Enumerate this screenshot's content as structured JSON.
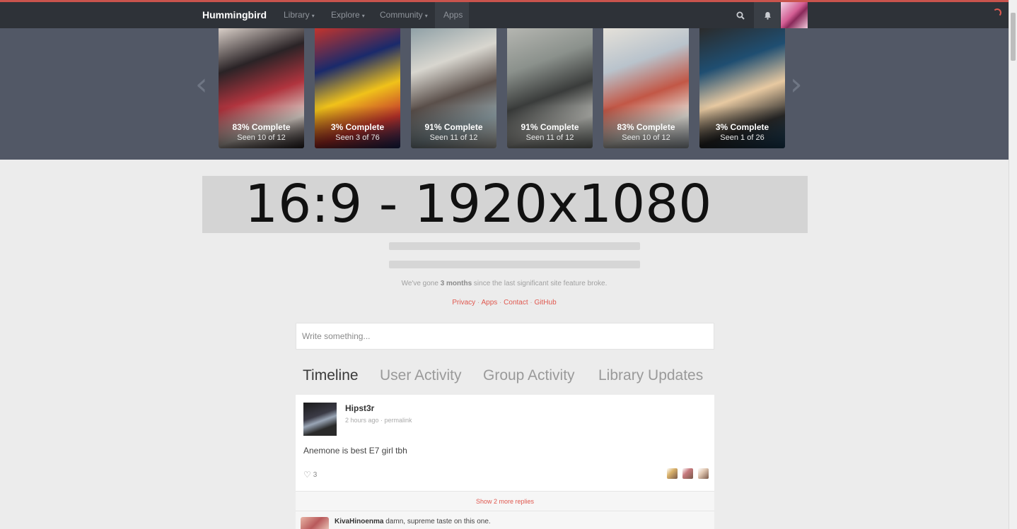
{
  "nav": {
    "brand": "Hummingbird",
    "items": [
      {
        "label": "Library",
        "dropdown": true
      },
      {
        "label": "Explore",
        "dropdown": true
      },
      {
        "label": "Community",
        "dropdown": true
      },
      {
        "label": "Apps",
        "dropdown": false
      }
    ],
    "caret": "▾",
    "icons": [
      "search-icon",
      "bell-icon",
      "user-avatar",
      "loading-spinner-icon"
    ]
  },
  "carousel": {
    "prev": "‹",
    "next": "›",
    "cards": [
      {
        "percent": "83% Complete",
        "seen": "Seen 10 of 12",
        "art_colors": [
          "#2a2326",
          "#b0343e",
          "#d9cfc8"
        ]
      },
      {
        "percent": "3% Complete",
        "seen": "Seen 3 of 76",
        "art_colors": [
          "#1a2a6b",
          "#f0c21a",
          "#c3342c"
        ]
      },
      {
        "percent": "91% Complete",
        "seen": "Seen 11 of 12",
        "art_colors": [
          "#d8d6cf",
          "#5a4f4a",
          "#8fa0a6"
        ]
      },
      {
        "percent": "91% Complete",
        "seen": "Seen 11 of 12",
        "art_colors": [
          "#8b918c",
          "#3a3c3b",
          "#b5b6b1"
        ]
      },
      {
        "percent": "83% Complete",
        "seen": "Seen 10 of 12",
        "art_colors": [
          "#b9c3cc",
          "#c25746",
          "#e5e1d9"
        ]
      },
      {
        "percent": "3% Complete",
        "seen": "Seen 1 of 26",
        "art_colors": [
          "#1f4e71",
          "#e7c9a1",
          "#2b2b2b"
        ]
      }
    ]
  },
  "banner": {
    "text": "16:9 - 1920x1080"
  },
  "status": {
    "before": "We've gone ",
    "highlight": "3 months",
    "after": " since the last significant site feature broke."
  },
  "footer_links": [
    "Privacy",
    "Apps",
    "Contact",
    "GitHub"
  ],
  "footer_sep": " · ",
  "composer": {
    "placeholder": "Write something..."
  },
  "tabs": [
    "Timeline",
    "User Activity",
    "Group Activity",
    "Library Updates"
  ],
  "active_tab": "Timeline",
  "post": {
    "user": "Hipst3r",
    "time": "2 hours ago",
    "meta_sep": " · ",
    "permalink": "permalink",
    "body": "Anemone is best E7 girl tbh",
    "likes": "3",
    "heart": "♡",
    "liker_colors": [
      "#d9b16a",
      "#c77a7e",
      "#e0c7b2"
    ]
  },
  "more_replies": "Show 2 more replies",
  "reply": {
    "user": "KivaHinoenma",
    "text": " damn, supreme taste on this one."
  },
  "colors": {
    "accent": "#e0584f",
    "nav_bg": "#2e3238",
    "carousel_bg": "#525866",
    "page_bg": "#ececec"
  }
}
